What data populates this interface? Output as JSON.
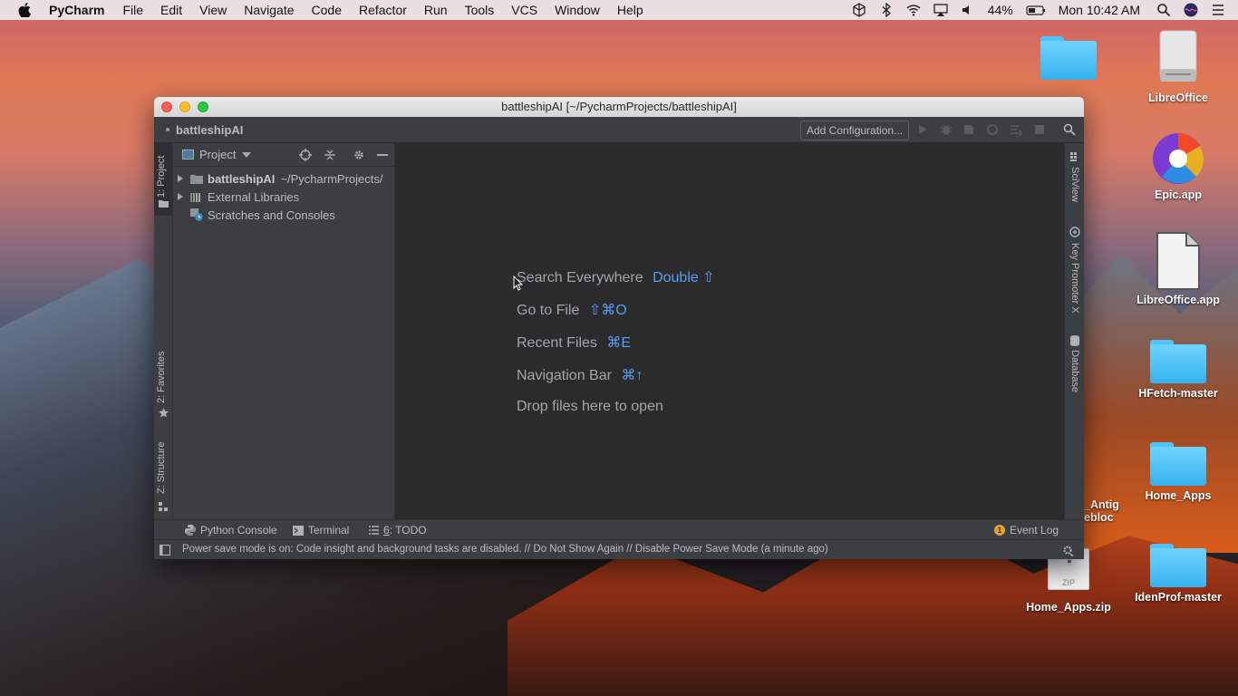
{
  "menubar": {
    "app_name": "PyCharm",
    "items": [
      "File",
      "Edit",
      "View",
      "Navigate",
      "Code",
      "Refactor",
      "Run",
      "Tools",
      "VCS",
      "Window",
      "Help"
    ],
    "battery": "44%",
    "clock": "Mon 10:42 AM"
  },
  "desktop": {
    "icons": [
      {
        "label": "LibreOffice",
        "type": "drive"
      },
      {
        "label": "Epic.app",
        "type": "app"
      },
      {
        "label": "LibreOffice.app",
        "type": "document"
      },
      {
        "label": "HFetch-master",
        "type": "folder"
      },
      {
        "label": "Home_Apps",
        "type": "folder"
      },
      {
        "label": "IdenProf-master",
        "type": "folder"
      },
      {
        "label": "Home_Apps.zip",
        "type": "zip"
      },
      {
        "label": "_Antig",
        "type": "partial"
      },
      {
        "label": "ebloc",
        "type": "partial"
      }
    ],
    "zip_badge": "ZIP"
  },
  "window": {
    "title": "battleshipAI [~/PycharmProjects/battleshipAI]",
    "breadcrumb": "battleshipAI",
    "add_configuration": "Add Configuration...",
    "left_tabs": [
      "1: Project",
      "2: Favorites",
      "Z: Structure"
    ],
    "right_tabs": [
      "SciView",
      "Key Promoter X",
      "Database"
    ],
    "project_panel": {
      "header": "Project",
      "tree": [
        {
          "name": "battleshipAI",
          "path": "~/PycharmProjects/",
          "expandable": true
        },
        {
          "name": "External Libraries",
          "path": "",
          "expandable": true
        },
        {
          "name": "Scratches and Consoles",
          "path": "",
          "expandable": false
        }
      ]
    },
    "editor_hints": [
      {
        "label": "Search Everywhere",
        "shortcut": "Double ⇧"
      },
      {
        "label": "Go to File",
        "shortcut": "⇧⌘O"
      },
      {
        "label": "Recent Files",
        "shortcut": "⌘E"
      },
      {
        "label": "Navigation Bar",
        "shortcut": "⌘↑"
      },
      {
        "label": "Drop files here to open",
        "shortcut": ""
      }
    ],
    "bottom_tools": {
      "python_console": "Python Console",
      "terminal": "Terminal",
      "todo_num": "6",
      "todo": ": TODO",
      "event_log": "Event Log",
      "event_count": "1"
    },
    "status": "Power save mode is on: Code insight and background tasks are disabled. // Do Not Show Again // Disable Power Save Mode (a minute ago)"
  }
}
